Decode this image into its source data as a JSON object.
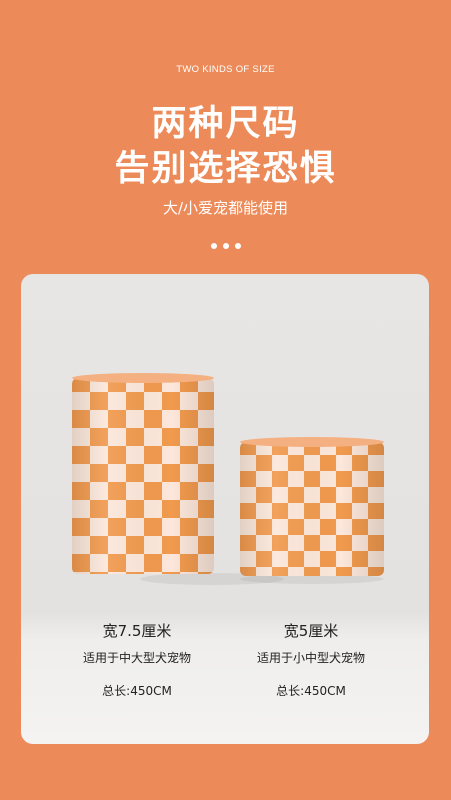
{
  "header": {
    "eyebrow": "TWO KINDS OF SIZE",
    "title_line1": "两种尺码",
    "title_line2": "告别选择恐惧",
    "subtitle": "大/小爱宠都能使用"
  },
  "products": [
    {
      "width_label": "宽7.5厘米",
      "usage": "适用于中大型犬宠物",
      "length": "总长:450CM"
    },
    {
      "width_label": "宽5厘米",
      "usage": "适用于小中型犬宠物",
      "length": "总长:450CM"
    }
  ],
  "colors": {
    "background": "#EC8B59",
    "checker_orange": "#F19A4E",
    "checker_light": "#FCE7DA"
  }
}
